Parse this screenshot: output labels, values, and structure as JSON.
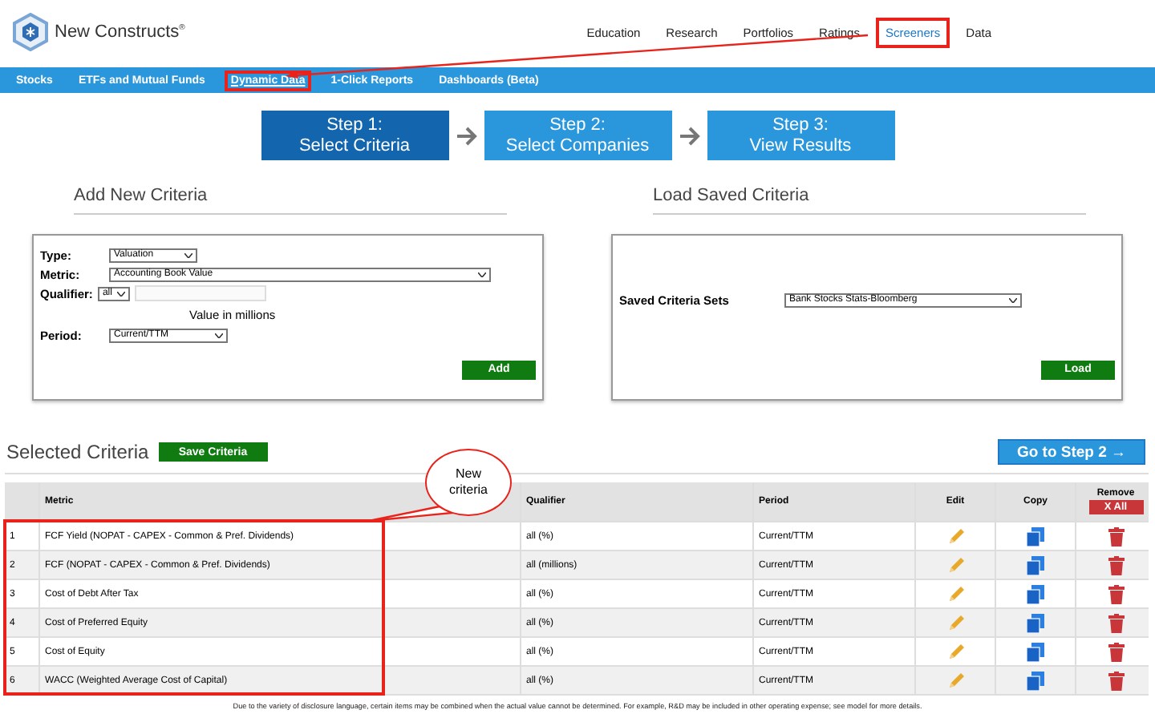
{
  "brand": {
    "name": "New Constructs",
    "mark": "®"
  },
  "main_nav": [
    {
      "label": "Education",
      "selected": false,
      "highlighted": false
    },
    {
      "label": "Research",
      "selected": false,
      "highlighted": false
    },
    {
      "label": "Portfolios",
      "selected": false,
      "highlighted": false
    },
    {
      "label": "Ratings",
      "selected": false,
      "highlighted": false
    },
    {
      "label": "Screeners",
      "selected": true,
      "highlighted": true
    },
    {
      "label": "Data",
      "selected": false,
      "highlighted": false
    }
  ],
  "sub_nav": [
    {
      "label": "Stocks",
      "selected": false,
      "highlighted": false
    },
    {
      "label": "ETFs and Mutual Funds",
      "selected": false,
      "highlighted": false
    },
    {
      "label": "Dynamic Data",
      "selected": true,
      "highlighted": true
    },
    {
      "label": "1-Click Reports",
      "selected": false,
      "highlighted": false
    },
    {
      "label": "Dashboards (Beta)",
      "selected": false,
      "highlighted": false
    }
  ],
  "steps": [
    {
      "title": "Step 1:",
      "subtitle": "Select Criteria",
      "selected": true
    },
    {
      "title": "Step 2:",
      "subtitle": "Select Companies",
      "selected": false
    },
    {
      "title": "Step 3:",
      "subtitle": "View Results",
      "selected": false
    }
  ],
  "add_criteria": {
    "heading": "Add New Criteria",
    "type_label": "Type:",
    "type_value": "Valuation",
    "metric_label": "Metric:",
    "metric_value": "Accounting Book Value",
    "qualifier_label": "Qualifier:",
    "qualifier_value": "all",
    "value_note": "Value in millions",
    "period_label": "Period:",
    "period_value": "Current/TTM",
    "button": "Add"
  },
  "load_criteria": {
    "heading": "Load Saved Criteria",
    "sets_label": "Saved Criteria Sets",
    "sets_value": "Bank Stocks Stats-Bloomberg",
    "button": "Load"
  },
  "selected_criteria": {
    "heading": "Selected Criteria",
    "save_button": "Save Criteria",
    "next_button": "Go to Step 2 →"
  },
  "table": {
    "columns": [
      "Metric",
      "Qualifier",
      "Period",
      "Edit",
      "Copy",
      "Remove"
    ],
    "remove_all": "X All",
    "rows_highlighted": true,
    "rows": [
      {
        "index": "1",
        "metric": "FCF Yield (NOPAT - CAPEX - Common & Pref. Dividends)",
        "qualifier": "all (%)",
        "period": "Current/TTM"
      },
      {
        "index": "2",
        "metric": "FCF (NOPAT - CAPEX - Common & Pref. Dividends)",
        "qualifier": "all (millions)",
        "period": "Current/TTM"
      },
      {
        "index": "3",
        "metric": "Cost of Debt After Tax",
        "qualifier": "all (%)",
        "period": "Current/TTM"
      },
      {
        "index": "4",
        "metric": "Cost of Preferred Equity",
        "qualifier": "all (%)",
        "period": "Current/TTM"
      },
      {
        "index": "5",
        "metric": "Cost of Equity",
        "qualifier": "all (%)",
        "period": "Current/TTM"
      },
      {
        "index": "6",
        "metric": "WACC (Weighted Average Cost of Capital)",
        "qualifier": "all (%)",
        "period": "Current/TTM"
      }
    ]
  },
  "callout": {
    "text": "New criteria"
  },
  "footnote": "Due to the variety of disclosure language, certain items may be combined when the actual value cannot be determined. For example, R&D may be included in other operating expense; see model for more details."
}
